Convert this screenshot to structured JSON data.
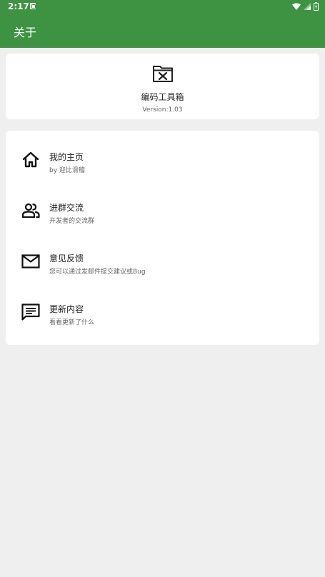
{
  "status_bar": {
    "time": "2:17"
  },
  "app_bar": {
    "title": "关于"
  },
  "about": {
    "app_name": "编码工具箱",
    "version": "Version:1.03"
  },
  "menu": {
    "items": [
      {
        "title": "我的主页",
        "subtitle": "by 迎比滑稽",
        "icon": "home-icon"
      },
      {
        "title": "进群交流",
        "subtitle": "开发者的交流群",
        "icon": "people-icon"
      },
      {
        "title": "意见反馈",
        "subtitle": "您可以通过发邮件提交建议或Bug",
        "icon": "mail-icon"
      },
      {
        "title": "更新内容",
        "subtitle": "看看更新了什么",
        "icon": "message-icon"
      }
    ]
  },
  "colors": {
    "app_bar": "#3e9342",
    "background": "#efefef",
    "card": "#ffffff"
  }
}
